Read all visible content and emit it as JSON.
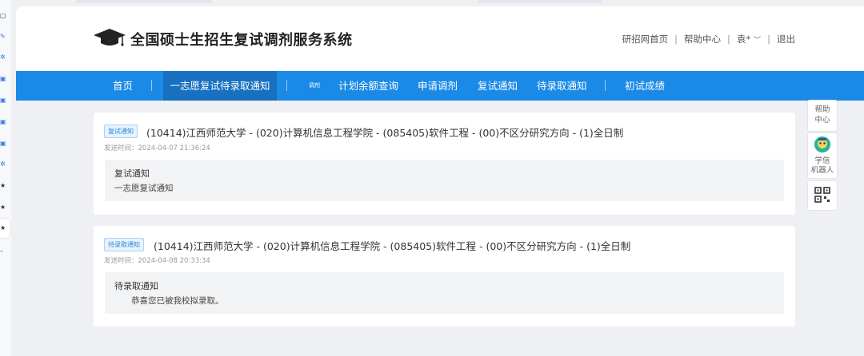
{
  "site": {
    "title": "全国硕士生招生复试调剂服务系统"
  },
  "top_links": {
    "home": "研招网首页",
    "help": "帮助中心",
    "user": "袁*",
    "logout": "退出"
  },
  "nav": {
    "items": [
      {
        "label": "首页"
      },
      {
        "label": "一志愿复试待录取通知"
      },
      {
        "label": "调剂"
      },
      {
        "label": "计划余额查询"
      },
      {
        "label": "申请调剂"
      },
      {
        "label": "复试通知"
      },
      {
        "label": "待录取通知"
      },
      {
        "label": "初试成绩"
      }
    ]
  },
  "notices": [
    {
      "tag": "复试通知",
      "title": "(10414)江西师范大学 - (020)计算机信息工程学院 - (085405)软件工程 - (00)不区分研究方向 - (1)全日制",
      "time_label": "发送时间：",
      "time": "2024-04-07 21:36:24",
      "heading": "复试通知",
      "body": "一志愿复试通知"
    },
    {
      "tag": "待录取通知",
      "title": "(10414)江西师范大学 - (020)计算机信息工程学院 - (085405)软件工程 - (00)不区分研究方向 - (1)全日制",
      "time_label": "发送时间：",
      "time": "2024-04-08 20:33:34",
      "heading": "待录取通知",
      "body": "恭喜您已被我校拟录取。"
    }
  ],
  "floating": {
    "help_line1": "帮助",
    "help_line2": "中心",
    "robot_line1": "学信",
    "robot_line2": "机器人"
  },
  "colors": {
    "nav_bg": "#1b8ae6",
    "nav_active": "#1770c0",
    "tag_blue": "#2a8ad6"
  }
}
